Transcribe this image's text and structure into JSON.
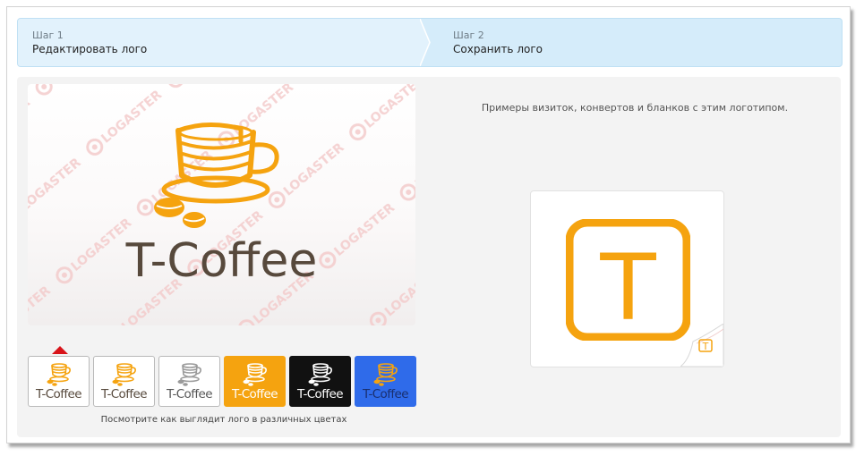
{
  "steps": [
    {
      "small": "Шаг 1",
      "label": "Редактировать лого"
    },
    {
      "small": "Шаг 2",
      "label": "Сохранить лого"
    }
  ],
  "logo": {
    "name": "T-Coffee",
    "watermark": "LOGASTER",
    "primary_color": "#f5a30f",
    "text_color": "#57493c"
  },
  "variants": [
    {
      "name": "T-Coffee",
      "bg": "#ffffff",
      "text": "#57493c",
      "cup": "#f5a30f",
      "selected": true
    },
    {
      "name": "T-Coffee",
      "bg": "#ffffff",
      "text": "#57493c",
      "cup": "#f5a30f",
      "selected": false
    },
    {
      "name": "T-Coffee",
      "bg": "#ffffff",
      "text": "#555555",
      "cup": "#9a9a9a",
      "selected": false
    },
    {
      "name": "T-Coffee",
      "bg": "#f5a30f",
      "text": "#ffffff",
      "cup": "#ffffff",
      "selected": false
    },
    {
      "name": "T-Coffee",
      "bg": "#111111",
      "text": "#ffffff",
      "cup": "#ffffff",
      "selected": false
    },
    {
      "name": "T-Coffee",
      "bg": "#2f6bea",
      "text": "#1a2f6e",
      "cup": "#f5a30f",
      "selected": false
    }
  ],
  "caption_variants": "Посмотрите как выглядит лого в различных цветах",
  "caption_examples": "Примеры визиток, конвертов и бланков с этим логотипом.",
  "card_letter": "T"
}
